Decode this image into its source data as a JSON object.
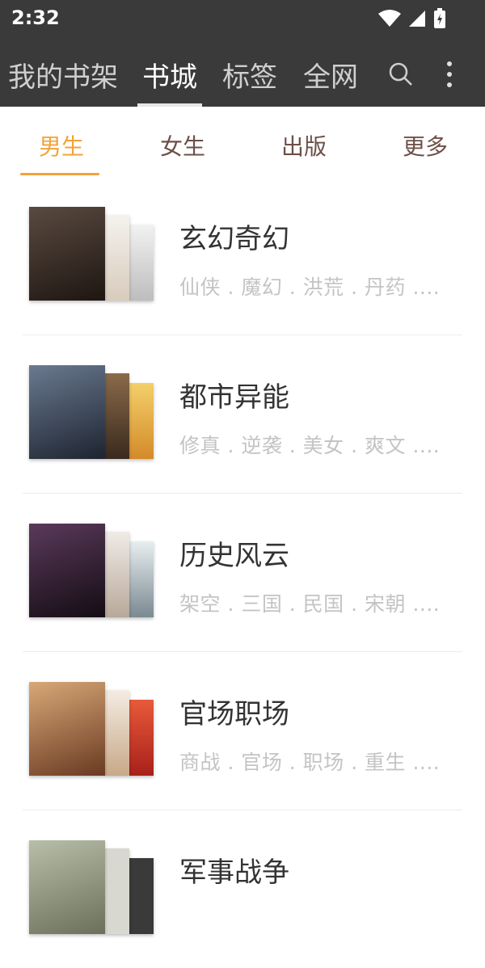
{
  "status": {
    "time": "2:32"
  },
  "appbar": {
    "tabs": [
      {
        "label": "我的书架"
      },
      {
        "label": "书城"
      },
      {
        "label": "标签"
      },
      {
        "label": "全网"
      }
    ]
  },
  "categories": [
    {
      "label": "男生"
    },
    {
      "label": "女生"
    },
    {
      "label": "出版"
    },
    {
      "label": "更多"
    }
  ],
  "genres": [
    {
      "title": "玄幻奇幻",
      "tags": "仙侠 . 魔幻 . 洪荒 . 丹药 ....",
      "cover_colors": [
        "#3b2a22",
        "#e8e0d4",
        "#d9d9d9"
      ]
    },
    {
      "title": "都市异能",
      "tags": "修真 . 逆袭 . 美女 . 爽文 ....",
      "cover_colors": [
        "#2f3a4a",
        "#6b4a2e",
        "#e0b04a"
      ]
    },
    {
      "title": "历史风云",
      "tags": "架空 . 三国 . 民国 . 宋朝 ....",
      "cover_colors": [
        "#2a1f2c",
        "#d8cfc8",
        "#8fa0a8"
      ]
    },
    {
      "title": "官场职场",
      "tags": "商战 . 官场 . 职场 . 重生 ....",
      "cover_colors": [
        "#b8875a",
        "#e8d8c8",
        "#c83a2a"
      ]
    },
    {
      "title": "军事战争",
      "tags": "",
      "cover_colors": [
        "#9aa08a",
        "#d8d8d0",
        "#3a3a3a"
      ]
    }
  ]
}
